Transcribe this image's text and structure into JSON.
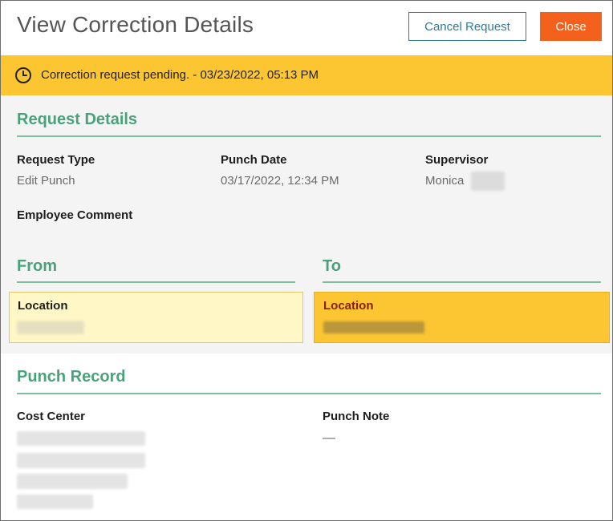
{
  "header": {
    "title": "View Correction Details",
    "cancel_label": "Cancel Request",
    "close_label": "Close"
  },
  "banner": {
    "icon": "clock-icon",
    "text": "Correction request pending. - 03/23/2022, 05:13 PM"
  },
  "request_details": {
    "title": "Request Details",
    "request_type_label": "Request Type",
    "request_type_value": "Edit Punch",
    "punch_date_label": "Punch Date",
    "punch_date_value": "03/17/2022, 12:34 PM",
    "supervisor_label": "Supervisor",
    "supervisor_value": "Monica",
    "employee_comment_label": "Employee Comment"
  },
  "from": {
    "title": "From",
    "location_label": "Location"
  },
  "to": {
    "title": "To",
    "location_label": "Location"
  },
  "punch_record": {
    "title": "Punch Record",
    "cost_center_label": "Cost Center",
    "punch_note_label": "Punch Note",
    "punch_note_value": "—"
  },
  "colors": {
    "accent_green": "#4aa27b",
    "banner_yellow": "#fcc632",
    "close_orange": "#f4611d",
    "cancel_blue": "#2f7a96",
    "to_label_red": "#8a1d0e"
  }
}
